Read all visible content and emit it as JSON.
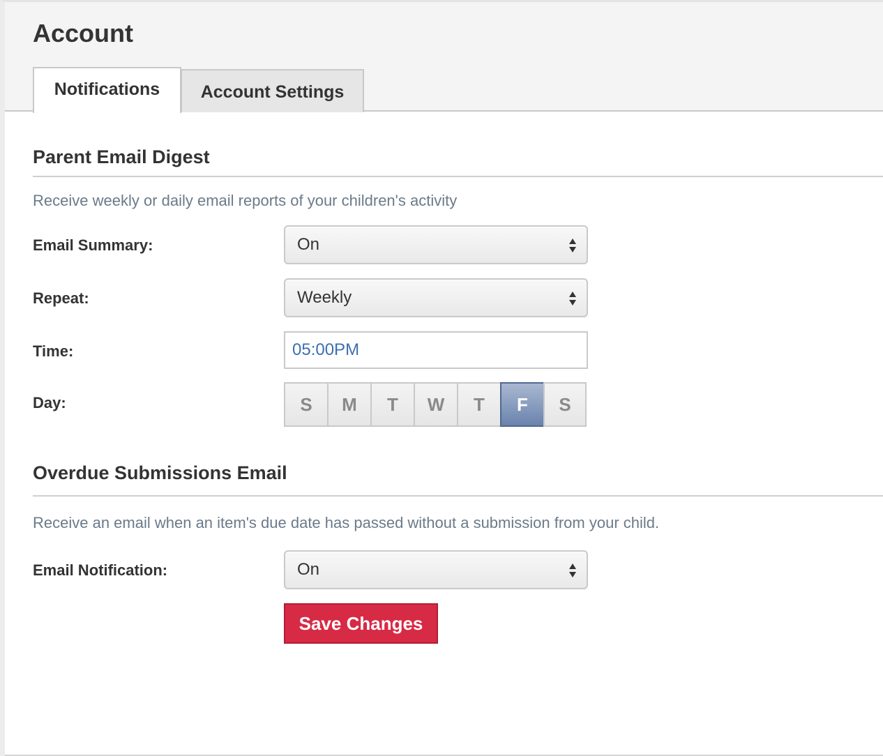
{
  "page": {
    "title": "Account"
  },
  "tabs": [
    {
      "label": "Notifications",
      "active": true
    },
    {
      "label": "Account Settings",
      "active": false
    }
  ],
  "digest": {
    "title": "Parent Email Digest",
    "description": "Receive weekly or daily email reports of your children's activity",
    "email_summary": {
      "label": "Email Summary:",
      "value": "On"
    },
    "repeat": {
      "label": "Repeat:",
      "value": "Weekly"
    },
    "time": {
      "label": "Time:",
      "value": "05:00PM"
    },
    "day": {
      "label": "Day:",
      "options": [
        "S",
        "M",
        "T",
        "W",
        "T",
        "F",
        "S"
      ],
      "selected_index": 5
    }
  },
  "overdue": {
    "title": "Overdue Submissions Email",
    "description": "Receive an email when an item's due date has passed without a submission from your child.",
    "email_notification": {
      "label": "Email Notification:",
      "value": "On"
    }
  },
  "actions": {
    "save_label": "Save Changes"
  },
  "colors": {
    "accent_red": "#d72a45",
    "selected_day": "#6a83ad",
    "description_text": "#6b7a8a",
    "time_text": "#3d6fb0"
  },
  "icons": {
    "select_arrows": "up-down-arrows-icon"
  }
}
